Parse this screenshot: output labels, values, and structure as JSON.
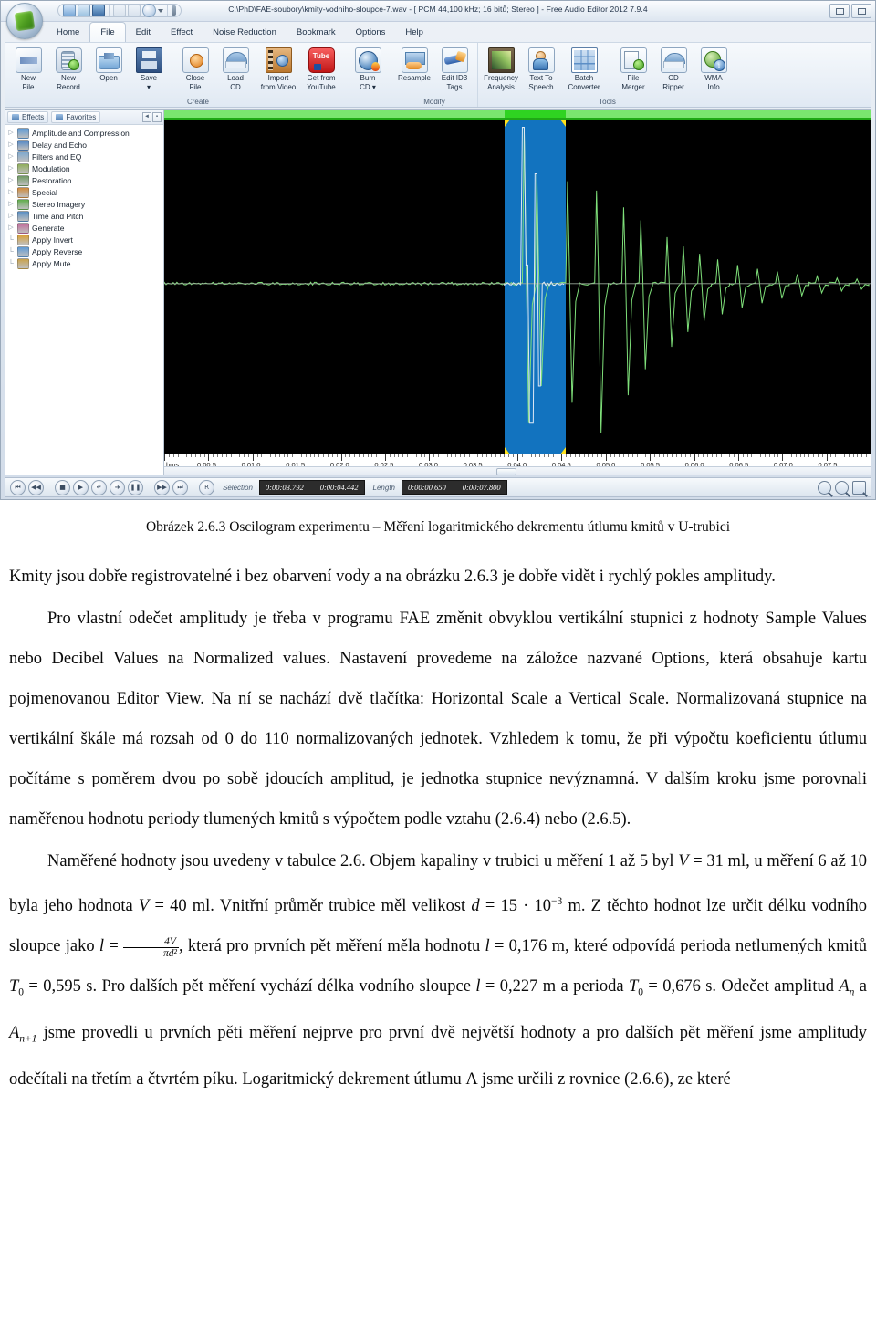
{
  "app": {
    "title": "C:\\PhD\\FAE-soubory\\kmity-vodniho-sloupce-7.wav - [ PCM 44,100 kHz; 16 bitů; Stereo ] - Free Audio Editor 2012 7.9.4",
    "quick_access": [
      "new-icon",
      "open-icon",
      "save-icon",
      "undo-icon",
      "redo-icon",
      "burn-icon",
      "dropdown-arrow",
      "customize-icon"
    ],
    "window_buttons": [
      "minimize",
      "restore"
    ],
    "tabs": [
      {
        "label": "Home",
        "active": false
      },
      {
        "label": "File",
        "active": true
      },
      {
        "label": "Edit",
        "active": false
      },
      {
        "label": "Effect",
        "active": false
      },
      {
        "label": "Noise Reduction",
        "active": false
      },
      {
        "label": "Bookmark",
        "active": false
      },
      {
        "label": "Options",
        "active": false
      },
      {
        "label": "Help",
        "active": false
      }
    ],
    "ribbon": {
      "groups": [
        {
          "name": "Create",
          "label": "Create",
          "buttons": [
            {
              "line1": "New",
              "line2": "File",
              "icon": "new-file-icon",
              "cls": "ico-newfile"
            },
            {
              "line1": "New",
              "line2": "Record",
              "icon": "new-record-icon",
              "cls": "ico-newrec"
            },
            {
              "line1": "Open",
              "line2": "",
              "icon": "open-folder-icon",
              "cls": "ico-open"
            },
            {
              "line1": "Save",
              "line2": "▾",
              "icon": "save-disk-icon",
              "cls": "ico-save"
            },
            {
              "sep": true
            },
            {
              "line1": "Close",
              "line2": "File",
              "icon": "close-file-icon",
              "cls": "ico-close"
            },
            {
              "line1": "Load",
              "line2": "CD",
              "icon": "load-cd-icon",
              "cls": "ico-loadcd"
            },
            {
              "line1": "Import",
              "line2": "from Video",
              "icon": "import-video-icon",
              "cls": "ico-video"
            },
            {
              "line1": "Get from",
              "line2": "YouTube",
              "icon": "youtube-icon",
              "cls": "ico-tube"
            },
            {
              "sep": true
            },
            {
              "line1": "Burn",
              "line2": "CD ▾",
              "icon": "burn-cd-icon",
              "cls": "ico-burn"
            }
          ]
        },
        {
          "name": "Modify",
          "label": "Modify",
          "buttons": [
            {
              "line1": "Resample",
              "line2": "",
              "icon": "resample-icon",
              "cls": "ico-resample"
            },
            {
              "line1": "Edit ID3",
              "line2": "Tags",
              "icon": "edit-id3-tags-icon",
              "cls": "ico-id3"
            }
          ]
        },
        {
          "name": "Tools",
          "label": "Tools",
          "buttons": [
            {
              "line1": "Frequency",
              "line2": "Analysis",
              "icon": "frequency-analysis-icon",
              "cls": "ico-freq"
            },
            {
              "line1": "Text To",
              "line2": "Speech",
              "icon": "text-to-speech-icon",
              "cls": "ico-tts"
            },
            {
              "line1": "Batch",
              "line2": "Converter",
              "icon": "batch-converter-icon",
              "cls": "ico-batch"
            },
            {
              "sep": true
            },
            {
              "line1": "File",
              "line2": "Merger",
              "icon": "file-merger-icon",
              "cls": "ico-merger"
            },
            {
              "line1": "CD",
              "line2": "Ripper",
              "icon": "cd-ripper-icon",
              "cls": "ico-ripper"
            },
            {
              "line1": "WMA",
              "line2": "Info",
              "icon": "wma-info-icon",
              "cls": "ico-wma"
            }
          ]
        }
      ]
    },
    "effects_panel": {
      "tabs": [
        {
          "label": "Effects",
          "icon": "effects-icon",
          "selected": true
        },
        {
          "label": "Favorites",
          "icon": "star-icon",
          "selected": false
        }
      ],
      "pin_buttons": [
        "◄",
        "▪"
      ],
      "items": [
        {
          "label": "Amplitude and Compression",
          "expandable": true,
          "color": "#5d9ad6"
        },
        {
          "label": "Delay and Echo",
          "expandable": true,
          "color": "#4f86c6"
        },
        {
          "label": "Filters and EQ",
          "expandable": true,
          "color": "#7fa9cf"
        },
        {
          "label": "Modulation",
          "expandable": true,
          "color": "#8fae5a"
        },
        {
          "label": "Restoration",
          "expandable": true,
          "color": "#6f9a63"
        },
        {
          "label": "Special",
          "expandable": true,
          "color": "#d08a3a"
        },
        {
          "label": "Stereo Imagery",
          "expandable": true,
          "color": "#5fae4a"
        },
        {
          "label": "Time and Pitch",
          "expandable": true,
          "color": "#5a8fc4"
        },
        {
          "label": "Generate",
          "expandable": true,
          "color": "#c06a9a"
        },
        {
          "label": "Apply Invert",
          "expandable": false,
          "color": "#d9a33a"
        },
        {
          "label": "Apply Reverse",
          "expandable": false,
          "color": "#5d9ad6"
        },
        {
          "label": "Apply Mute",
          "expandable": false,
          "color": "#c9a24a"
        }
      ]
    },
    "timeline": {
      "unit_label": "hms",
      "tick_labels": [
        "0:00.5",
        "0:01.0",
        "0:01.5",
        "0:02.0",
        "0:02.5",
        "0:03.0",
        "0:03.5",
        "0:04.0",
        "0:04.5",
        "0:05.0",
        "0:05.5",
        "0:06.0",
        "0:06.5",
        "0:07.0",
        "0:07.5"
      ]
    },
    "statusbar": {
      "transport": [
        {
          "name": "go-to-start-button",
          "glyph": "⏮"
        },
        {
          "name": "rewind-button",
          "glyph": "◀◀"
        },
        {
          "name": "stop-button",
          "glyph": "■"
        },
        {
          "name": "play-button",
          "glyph": "▶"
        },
        {
          "name": "play-selection-button",
          "glyph": "↵"
        },
        {
          "name": "play-to-end-button",
          "glyph": "➜"
        },
        {
          "name": "pause-button",
          "glyph": "❚❚"
        },
        {
          "name": "fast-forward-button",
          "glyph": "▶▶"
        },
        {
          "name": "go-to-end-button",
          "glyph": "⏭"
        },
        {
          "name": "record-button",
          "glyph": "R"
        }
      ],
      "selection_label": "Selection",
      "selection_start": "0:00:03.792",
      "selection_end": "0:00:04.442",
      "length_label": "Length",
      "length_value": "0:00:00.650",
      "total_value": "0:00:07.800",
      "zoom_buttons": [
        "zoom-in-icon",
        "zoom-out-icon",
        "zoom-to-selection-icon"
      ]
    },
    "colors": {
      "waveform": "#7fe07a",
      "selection": "#1273bf",
      "overview": "#7ae66f",
      "overview_selection": "#2fd321",
      "marker": "#ffe11a"
    }
  },
  "document": {
    "caption": "Obrázek 2.6.3 Oscilogram experimentu – Měření logaritmického dekrementu útlumu kmitů v U-trubici",
    "p1": "Kmity jsou dobře registrovatelné i bez obarvení vody a na obrázku 2.6.3 je dobře vidět i rychlý pokles amplitudy.",
    "p2_a": "Pro vlastní odečet amplitudy je třeba v programu FAE změnit obvyklou vertikální stupnici z hodnoty Sample Values nebo Decibel Values na Normalized values. Nastavení provedeme na záložce nazvané Options, která obsahuje kartu pojmenovanou Editor View. Na ní se nachází dvě tlačítka: Horizontal Scale a Vertical Scale. Normalizovaná stupnice na vertikální škále má rozsah od 0 do 110 normalizovaných jednotek. Vzhledem k tomu, že při výpočtu koeficientu útlumu počítáme s poměrem dvou po sobě jdoucích amplitud, je jednotka stupnice nevýznamná. V dalším kroku jsme porovnali naměřenou hodnotu periody tlumených kmitů s výpočtem podle vztahu (2.6.4) nebo (2.6.5).",
    "p3_seg1": "Naměřené hodnoty jsou uvedeny v tabulce 2.6. Objem kapaliny v trubici u měření 1 až 5 byl ",
    "p3_V1": "V",
    "p3_seg2": " = 31 ml, u měření 6 až 10 byla jeho hodnota ",
    "p3_V2": "V",
    "p3_seg3": " = 40 ml. Vnitřní průměr trubice měl velikost ",
    "p3_d": "d",
    "p3_seg4": " = 15 · 10",
    "p3_exp": "−3",
    "p3_seg5": " m. Z těchto hodnot lze určit délku vodního sloupce jako ",
    "p3_l": "l",
    "p3_seg6": " = ",
    "p3_frac_num": "4V",
    "p3_frac_den": "πd²",
    "p3_seg7": ", která pro prvních pět měření měla hodnotu ",
    "p3_l2": "l",
    "p3_seg8": " = 0,176 m, které odpovídá perioda netlumených kmitů ",
    "p3_T1": "T",
    "p3_T1sub": "0",
    "p3_seg9": " = 0,595 s. Pro dalších pět měření vychází délka vodního sloupce ",
    "p3_l3": "l",
    "p3_seg10": " = 0,227 m a perioda ",
    "p3_T2": "T",
    "p3_T2sub": "0",
    "p3_seg11": " = 0,676 s. Odečet amplitud ",
    "p3_An": "A",
    "p3_Ansub": "n",
    "p3_seg12": " a ",
    "p3_An1": "A",
    "p3_An1sub": "n+1",
    "p3_seg13": " jsme provedli u prvních pěti měření nejprve pro první dvě největší hodnoty a pro dalších pět měření jsme amplitudy odečítali na třetím a čtvrtém píku. Logaritmický dekrement útlumu Λ jsme určili z rovnice (2.6.6), ze které"
  }
}
